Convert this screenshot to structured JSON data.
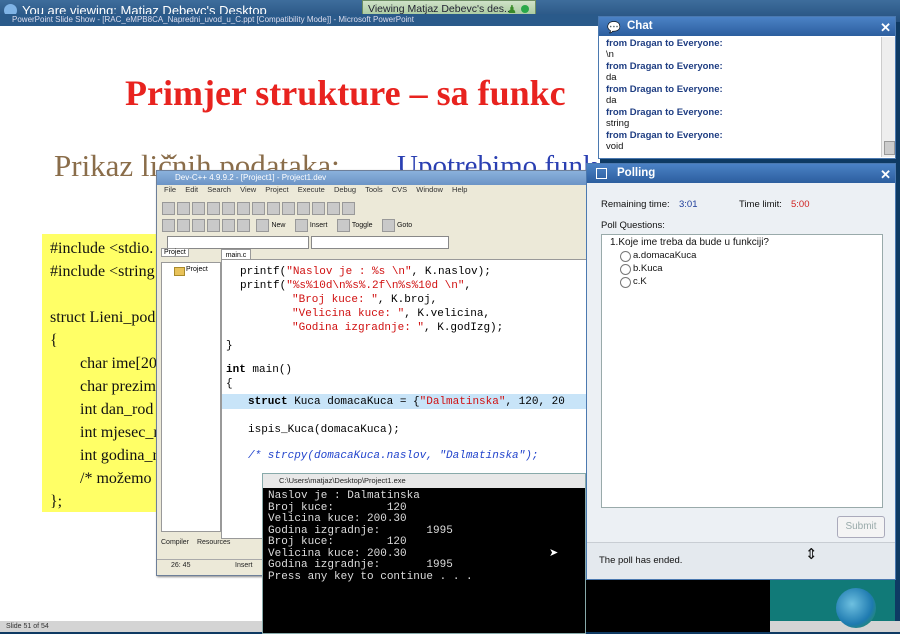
{
  "viewer": {
    "title": "You are viewing: Matjaz Debevc's Desktop",
    "tab_label": "Viewing Matjaz Debevc's des..."
  },
  "ppt": {
    "window_title": "PowerPoint Slide Show - [RAC_eMPB8CA_Napredni_uvod_u_C.ppt [Compatibility Mode]] - Microsoft PowerPoint",
    "slide_title": "Primjer strukture – sa funkc",
    "subtitle": "Prikaz lič̌nih podataka:",
    "subtitle_blue": "Upotrebimo funk",
    "code_lines": [
      "#include <stdio.",
      "#include <string",
      "struct Lieni_pod",
      "{",
      "char ime[20",
      "char prezim",
      "int dan_rod",
      "int mjesec_r",
      "int godina_r",
      "/* možemo",
      "};"
    ],
    "status": "Slide 51 of 54"
  },
  "devcpp": {
    "title": "Dev-C++ 4.9.9.2 - [Project1] - Project1.dev",
    "menu": [
      "File",
      "Edit",
      "Search",
      "View",
      "Project",
      "Execute",
      "Debug",
      "Tools",
      "CVS",
      "Window",
      "Help"
    ],
    "toolbar": {
      "new": "New",
      "insert": "Insert",
      "toggle": "Toggle",
      "goto": "Goto"
    },
    "project_tab": "Project",
    "project_item": "Project",
    "editor_tab": "main.c",
    "code": {
      "l1a": "printf(",
      "l1s": "\"Naslov je : %s \\n\"",
      "l1b": ", K.naslov);",
      "l2a": "printf(",
      "l2s": "\"%s%10d\\n%s%.2f\\n%s%10d \\n\"",
      "l2b": ",",
      "l3s": "\"Broj kuce: \"",
      "l3b": ", K.broj,",
      "l4s": "\"Velicina kuce: \"",
      "l4b": ", K.velicina,",
      "l5s": "\"Godina izgradnje: \"",
      "l5b": ", K.godIzg);",
      "l6": "}",
      "l7kw": "int",
      "l7b": " main()",
      "l8": "{",
      "l9kw": "struct",
      "l9b": " Kuca domacaKuca = {",
      "l9s": "\"Dalmatinska\"",
      "l9c": ", 120, 20",
      "l10": "ispis_Kuca(domacaKuca);",
      "l11": "/* strcpy(domacaKuca.naslov, \"Dalmatinska\");"
    },
    "bottom_tabs": [
      "Compiler",
      "Resources"
    ],
    "status_pos": "26: 45",
    "status_mode": "Insert"
  },
  "console": {
    "title": "C:\\Users\\matjaz\\Desktop\\Project1.exe",
    "lines": [
      "Naslov je : Dalmatinska",
      "Broj kuce:        120",
      "Velicina kuce: 200.30",
      "Godina izgradnje:       1995",
      "Broj kuce:        120",
      "Velicina kuce: 200.30",
      "Godina izgradnje:       1995",
      "Press any key to continue . . ."
    ]
  },
  "chat": {
    "title": "Chat",
    "messages": [
      {
        "from": "from Dragan to Everyone:",
        "text": "\\n"
      },
      {
        "from": "from Dragan to Everyone:",
        "text": "da"
      },
      {
        "from": "from Dragan to Everyone:",
        "text": "da"
      },
      {
        "from": "from Dragan to Everyone:",
        "text": "string"
      },
      {
        "from": "from Dragan to Everyone:",
        "text": "void"
      }
    ]
  },
  "polling": {
    "title": "Polling",
    "remaining_label": "Remaining time:",
    "remaining_value": "3:01",
    "limit_label": "Time limit:",
    "limit_value": "5:00",
    "questions_label": "Poll Questions:",
    "question": "1.Koje ime treba da bude u funkciji?",
    "options": [
      "a.domacaKuca",
      "b.Kuca",
      "c.K"
    ],
    "submit": "Submit",
    "status": "The poll has ended."
  },
  "colors": {
    "slide_title": "#e8231f",
    "chat_header": "#2c5e9e",
    "limit_value": "#d02020",
    "remaining_value": "#1e3d9a"
  }
}
